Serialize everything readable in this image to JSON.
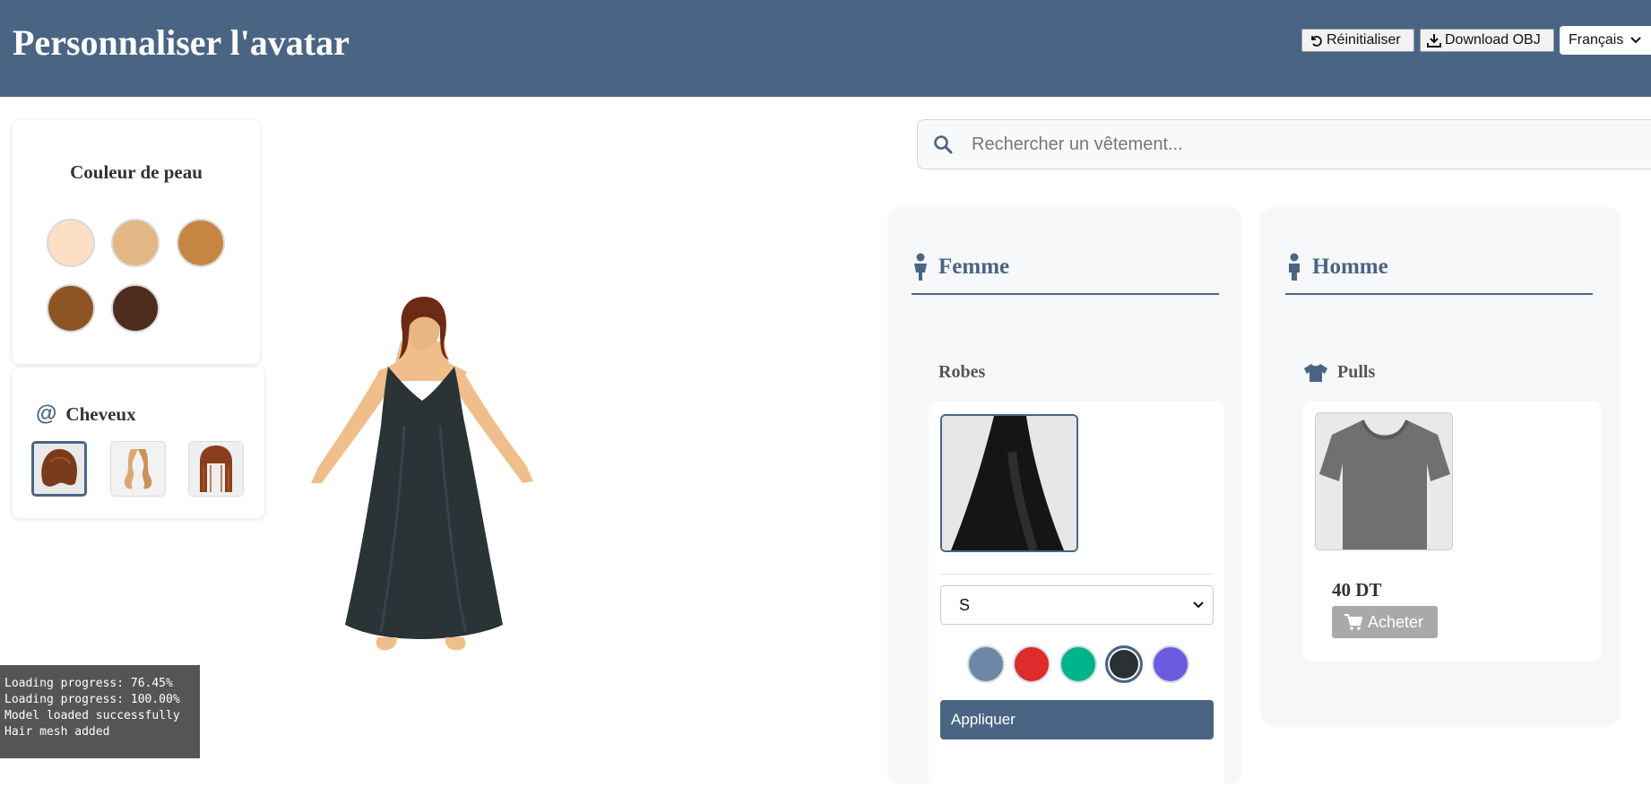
{
  "header": {
    "title": "Personnaliser l'avatar",
    "reset_label": "Réinitialiser",
    "download_label": "Download OBJ",
    "language_selected": "Français",
    "background_color": "#4a6584"
  },
  "skin": {
    "title": "Couleur de peau",
    "swatches": [
      "#fde0c4",
      "#e3b785",
      "#c68642",
      "#8d5524",
      "#4e2d1e"
    ]
  },
  "hair": {
    "title": "Cheveux",
    "icon": "at-sign-icon",
    "options": [
      "short-auburn-hair",
      "long-blonde-wavy-hair",
      "long-auburn-straight-hair"
    ],
    "selected_index": 0
  },
  "search": {
    "placeholder": "Rechercher un vêtement..."
  },
  "femme": {
    "title": "Femme",
    "icon": "female-person-icon",
    "category": "Robes",
    "item_image": "black-dress-thumbnail",
    "size_selected": "S",
    "colors": [
      "#6d87a8",
      "#dc2c2c",
      "#00b38a",
      "#2b3034",
      "#6b5be0"
    ],
    "selected_color_index": 3,
    "apply_label": "Appliquer"
  },
  "homme": {
    "title": "Homme",
    "icon": "male-person-icon",
    "category": "Pulls",
    "category_icon": "tshirt-icon",
    "item_image": "grey-tshirt-thumbnail",
    "price": "40 DT",
    "buy_label": "Acheter"
  },
  "log": {
    "lines": [
      "Loading progress: 76.45%",
      "Loading progress: 100.00%",
      "Model loaded successfully",
      "Hair mesh added"
    ]
  }
}
